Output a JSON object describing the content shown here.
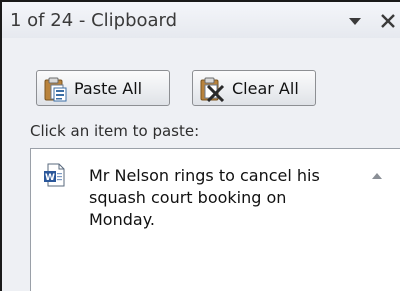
{
  "pane": {
    "title": "1 of 24 - Clipboard",
    "menu_icon": "triangle-down-icon",
    "close_icon": "close-icon"
  },
  "toolbar": {
    "paste_all_label": "Paste All",
    "clear_all_label": "Clear All",
    "paste_all_icon": "paste-all-icon",
    "clear_all_icon": "clear-all-icon"
  },
  "hint": "Click an item to paste:",
  "items": [
    {
      "icon": "word-document-icon",
      "text": "Mr Nelson rings to cancel his squash court booking on Monday."
    }
  ],
  "scroll_icon": "scroll-up-arrow-icon",
  "colors": {
    "pane_bg": "#eef0f4",
    "list_bg": "#ffffff",
    "word_blue": "#2b579a"
  }
}
